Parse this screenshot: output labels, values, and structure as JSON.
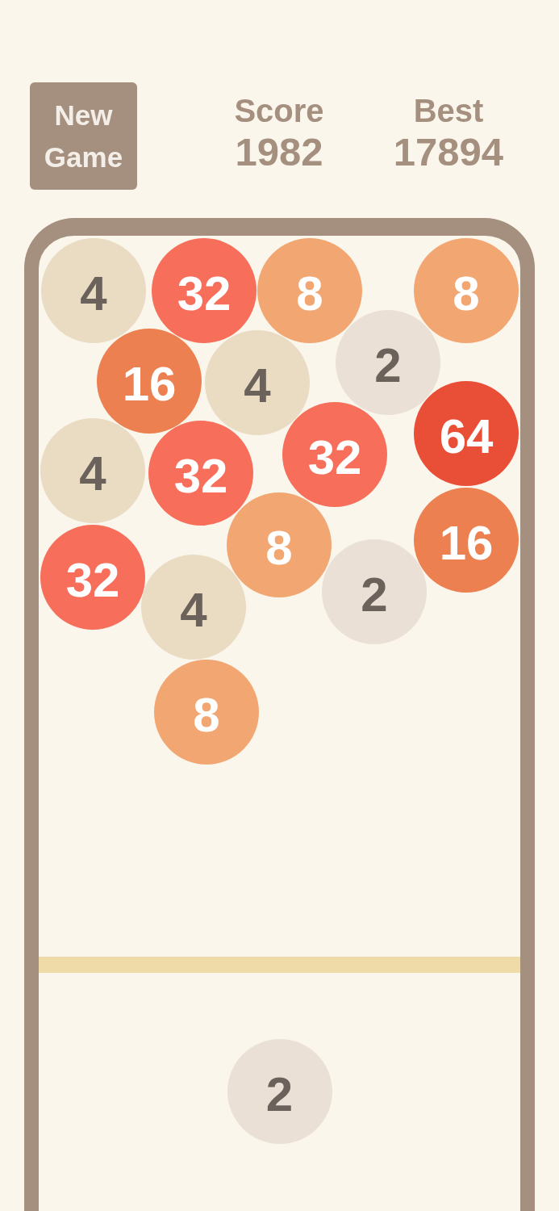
{
  "header": {
    "new_game_button": "New Game",
    "score": {
      "label": "Score",
      "value": "1982"
    },
    "best": {
      "label": "Best",
      "value": "17894"
    }
  },
  "board": {
    "balls": [
      {
        "label": "4",
        "color": "#eadbc3"
      },
      {
        "label": "32",
        "color": "#f76f5b"
      },
      {
        "label": "8",
        "color": "#f2a672"
      },
      {
        "label": "8",
        "color": "#f2a672"
      },
      {
        "label": "2",
        "color": "#ebe0d5"
      },
      {
        "label": "16",
        "color": "#ec8050"
      },
      {
        "label": "4",
        "color": "#eadbc3"
      },
      {
        "label": "64",
        "color": "#e94e37"
      },
      {
        "label": "4",
        "color": "#eadbc3"
      },
      {
        "label": "32",
        "color": "#f76f5b"
      },
      {
        "label": "32",
        "color": "#f76f5b"
      },
      {
        "label": "8",
        "color": "#f2a672"
      },
      {
        "label": "16",
        "color": "#ec8050"
      },
      {
        "label": "32",
        "color": "#f76f5b"
      },
      {
        "label": "2",
        "color": "#ebe0d5"
      },
      {
        "label": "4",
        "color": "#eadbc3"
      },
      {
        "label": "8",
        "color": "#f2a672"
      }
    ]
  },
  "next_ball": {
    "label": "2",
    "color": "#ebe0d5"
  }
}
